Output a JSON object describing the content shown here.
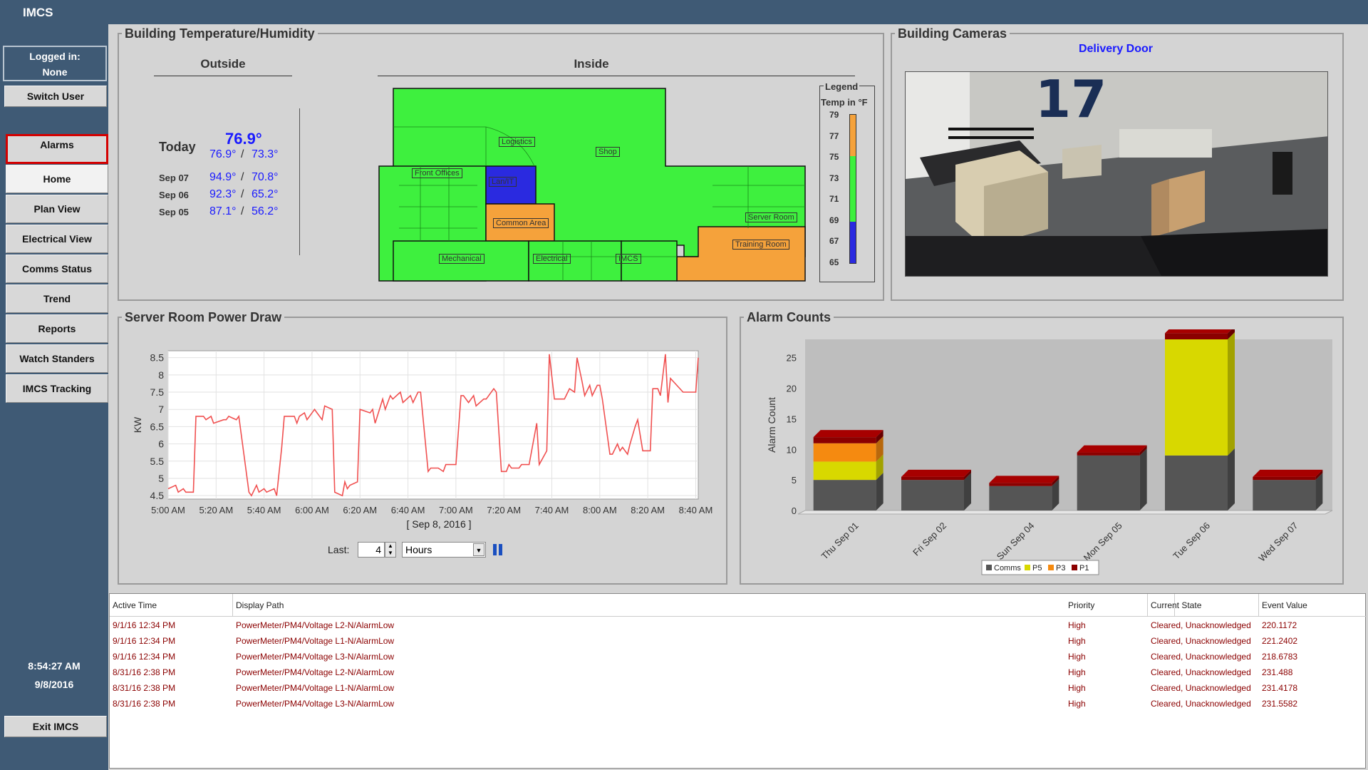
{
  "app": {
    "title": "IMCS"
  },
  "sidebar": {
    "login_label": "Logged in:",
    "login_user": "None",
    "switch_user": "Switch User",
    "alarms": "Alarms",
    "nav": [
      "Home",
      "Plan View",
      "Electrical View",
      "Comms Status",
      "Trend",
      "Reports",
      "Watch Standers",
      "IMCS Tracking"
    ],
    "active_nav": "Home",
    "time": "8:54:27 AM",
    "date": "9/8/2016",
    "exit": "Exit IMCS"
  },
  "temp_panel": {
    "title": "Building Temperature/Humidity",
    "outside_label": "Outside",
    "inside_label": "Inside",
    "today_label": "Today",
    "today_current": "76.9°",
    "today_high": "76.9°",
    "today_low": "73.3°",
    "sep": "/",
    "history": [
      {
        "date": "Sep 07",
        "high": "94.9°",
        "low": "70.8°"
      },
      {
        "date": "Sep 06",
        "high": "92.3°",
        "low": "65.2°"
      },
      {
        "date": "Sep 05",
        "high": "87.1°",
        "low": "56.2°"
      }
    ],
    "rooms": [
      "Logistics",
      "Shop",
      "Front Offices",
      "Lan/IT",
      "Common Area",
      "Server Room",
      "Training Room",
      "Mechanical",
      "Electrical",
      "IMCS"
    ],
    "legend": {
      "title": "Legend",
      "subtitle": "Temp in °F",
      "ticks": [
        "79",
        "77",
        "75",
        "73",
        "71",
        "69",
        "67",
        "65"
      ]
    },
    "colors": {
      "normal": "#3ef03e",
      "warm": "#f5a23b",
      "cool": "#2a2ae0"
    }
  },
  "camera_panel": {
    "title": "Building Cameras",
    "camera_name": "Delivery Door",
    "bay_number": "17"
  },
  "power_panel": {
    "title": "Server Room Power Draw",
    "last_label": "Last:",
    "last_value": "4",
    "unit_value": "Hours",
    "date_label": "[ Sep 8, 2016 ]"
  },
  "alarm_panel": {
    "title": "Alarm Counts"
  },
  "chart_data": [
    {
      "type": "line",
      "ylabel": "KW",
      "xlabel": "",
      "ylim": [
        4.4,
        8.7
      ],
      "yticks": [
        "4.5",
        "5",
        "5.5",
        "6",
        "6.5",
        "7",
        "7.5",
        "8",
        "8.5"
      ],
      "xticks": [
        "5:00 AM",
        "5:20 AM",
        "5:40 AM",
        "6:00 AM",
        "6:20 AM",
        "6:40 AM",
        "7:00 AM",
        "7:20 AM",
        "7:40 AM",
        "8:00 AM",
        "8:20 AM",
        "8:40 AM"
      ],
      "series": [
        {
          "color": "#f05050",
          "x": [
            0,
            3,
            4,
            6,
            7,
            10,
            11,
            14,
            15,
            17,
            18,
            22,
            23,
            24,
            27,
            28,
            32,
            33,
            35,
            36,
            38,
            39,
            42,
            43,
            45,
            46,
            50,
            51,
            52,
            54,
            55,
            58,
            59,
            61,
            62,
            65,
            66,
            69,
            70,
            71,
            72,
            75,
            76,
            80,
            81,
            82,
            85,
            86,
            88,
            89,
            92,
            93,
            96,
            97,
            99,
            100,
            103,
            104,
            106,
            107,
            109,
            110,
            113,
            114,
            116,
            117,
            119,
            121,
            122,
            125,
            126,
            129,
            130,
            132,
            134,
            135,
            136,
            139,
            140,
            142,
            143,
            146,
            147,
            150,
            151,
            153,
            154,
            157,
            159,
            161,
            162,
            164,
            165,
            167,
            168,
            170,
            171,
            172,
            175,
            176,
            178,
            179,
            180,
            182,
            183,
            185,
            186,
            188,
            191,
            192,
            194,
            195,
            197,
            198,
            199,
            204,
            209,
            210
          ],
          "values": [
            4.7,
            4.8,
            4.6,
            4.7,
            4.6,
            4.6,
            6.8,
            6.8,
            6.7,
            6.8,
            6.6,
            6.7,
            6.7,
            6.8,
            6.7,
            6.8,
            4.6,
            4.5,
            4.8,
            4.6,
            4.7,
            4.6,
            4.7,
            4.5,
            5.9,
            6.8,
            6.8,
            6.6,
            6.8,
            6.9,
            6.7,
            7.0,
            6.9,
            6.7,
            7.1,
            7.0,
            4.6,
            4.5,
            4.9,
            4.7,
            4.8,
            4.9,
            7.0,
            6.9,
            7.0,
            6.6,
            7.3,
            7.0,
            7.4,
            7.3,
            7.5,
            7.2,
            7.4,
            7.2,
            7.5,
            7.5,
            5.2,
            5.3,
            5.3,
            5.3,
            5.2,
            5.4,
            5.4,
            5.4,
            7.4,
            7.4,
            7.2,
            7.4,
            7.1,
            7.3,
            7.3,
            7.6,
            7.5,
            5.2,
            5.2,
            5.4,
            5.3,
            5.3,
            5.4,
            5.4,
            5.4,
            6.6,
            5.4,
            5.8,
            8.6,
            7.3,
            7.3,
            7.3,
            7.6,
            7.5,
            8.5,
            7.8,
            7.4,
            7.7,
            7.4,
            7.7,
            7.7,
            7.3,
            5.7,
            5.7,
            6.0,
            5.8,
            5.9,
            5.7,
            6.0,
            6.5,
            6.7,
            5.8,
            5.8,
            7.6,
            7.6,
            7.4,
            8.6,
            7.2,
            7.9,
            7.5,
            7.5,
            8.5
          ]
        }
      ]
    },
    {
      "type": "bar",
      "ylabel": "Alarm Count",
      "xlabel": "",
      "ylim": [
        0,
        28
      ],
      "yticks": [
        "0",
        "5",
        "10",
        "15",
        "20",
        "25"
      ],
      "categories": [
        "Thu Sep 01",
        "Fri Sep 02",
        "Sun Sep 04",
        "Mon Sep 05",
        "Tue Sep 06",
        "Wed Sep 07"
      ],
      "legend": "bottom",
      "series": [
        {
          "name": "Comms",
          "color": "#555555",
          "values": [
            5,
            5,
            4,
            9,
            9,
            5
          ]
        },
        {
          "name": "P5",
          "color": "#d8d800",
          "values": [
            3,
            0,
            0,
            0,
            19,
            0
          ]
        },
        {
          "name": "P3",
          "color": "#f58a10",
          "values": [
            3,
            0,
            0,
            0,
            0,
            0
          ]
        },
        {
          "name": "P1",
          "color": "#8b0000",
          "values": [
            1,
            0.5,
            0.5,
            0.5,
            1,
            0.5
          ]
        }
      ]
    }
  ],
  "alarm_table": {
    "headers": [
      "Active Time",
      "Display Path",
      "Priority",
      "Current State",
      "Event Value"
    ],
    "rows": [
      [
        "9/1/16 12:34 PM",
        "PowerMeter/PM4/Voltage L2-N/AlarmLow",
        "High",
        "Cleared, Unacknowledged",
        "220.1172"
      ],
      [
        "9/1/16 12:34 PM",
        "PowerMeter/PM4/Voltage L1-N/AlarmLow",
        "High",
        "Cleared, Unacknowledged",
        "221.2402"
      ],
      [
        "9/1/16 12:34 PM",
        "PowerMeter/PM4/Voltage L3-N/AlarmLow",
        "High",
        "Cleared, Unacknowledged",
        "218.6783"
      ],
      [
        "8/31/16 2:38 PM",
        "PowerMeter/PM4/Voltage L2-N/AlarmLow",
        "High",
        "Cleared, Unacknowledged",
        "231.488"
      ],
      [
        "8/31/16 2:38 PM",
        "PowerMeter/PM4/Voltage L1-N/AlarmLow",
        "High",
        "Cleared, Unacknowledged",
        "231.4178"
      ],
      [
        "8/31/16 2:38 PM",
        "PowerMeter/PM4/Voltage L3-N/AlarmLow",
        "High",
        "Cleared, Unacknowledged",
        "231.5582"
      ]
    ]
  }
}
